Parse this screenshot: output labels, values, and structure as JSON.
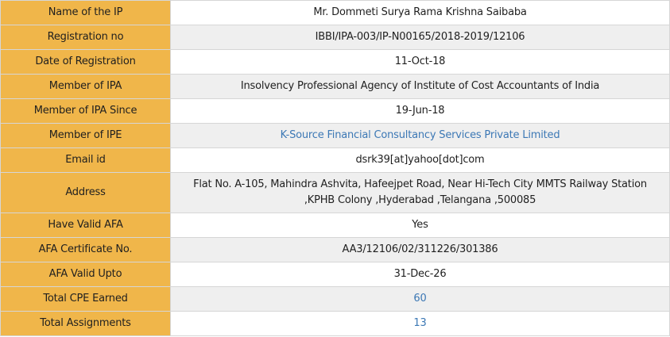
{
  "details": {
    "rows": [
      {
        "label": "Name of the IP",
        "value": "Mr. Dommeti Surya Rama Krishna Saibaba"
      },
      {
        "label": "Registration no",
        "value": "IBBI/IPA-003/IP-N00165/2018-2019/12106"
      },
      {
        "label": "Date of Registration",
        "value": "11-Oct-18"
      },
      {
        "label": "Member of IPA",
        "value": "Insolvency Professional Agency of Institute of Cost Accountants of India"
      },
      {
        "label": "Member of IPA Since",
        "value": "19-Jun-18"
      },
      {
        "label": "Member of IPE",
        "value": "K-Source Financial Consultancy Services Private Limited"
      },
      {
        "label": "Email id",
        "value": "dsrk39[at]yahoo[dot]com"
      },
      {
        "label": "Address",
        "value": "Flat No. A-105, Mahindra Ashvita, Hafeejpet Road, Near Hi-Tech City MMTS Railway Station ,KPHB Colony ,Hyderabad ,Telangana ,500085"
      },
      {
        "label": "Have Valid AFA",
        "value": "Yes"
      },
      {
        "label": "AFA Certificate No.",
        "value": "AA3/12106/02/311226/301386"
      },
      {
        "label": "AFA Valid Upto",
        "value": "31-Dec-26"
      },
      {
        "label": "Total CPE Earned",
        "value": "60"
      },
      {
        "label": "Total Assignments",
        "value": "13"
      }
    ]
  },
  "colors": {
    "label_background": "#f0b64a",
    "alt_row_background": "#efefef",
    "link": "#3c78b5",
    "border": "#d6d6d6"
  }
}
